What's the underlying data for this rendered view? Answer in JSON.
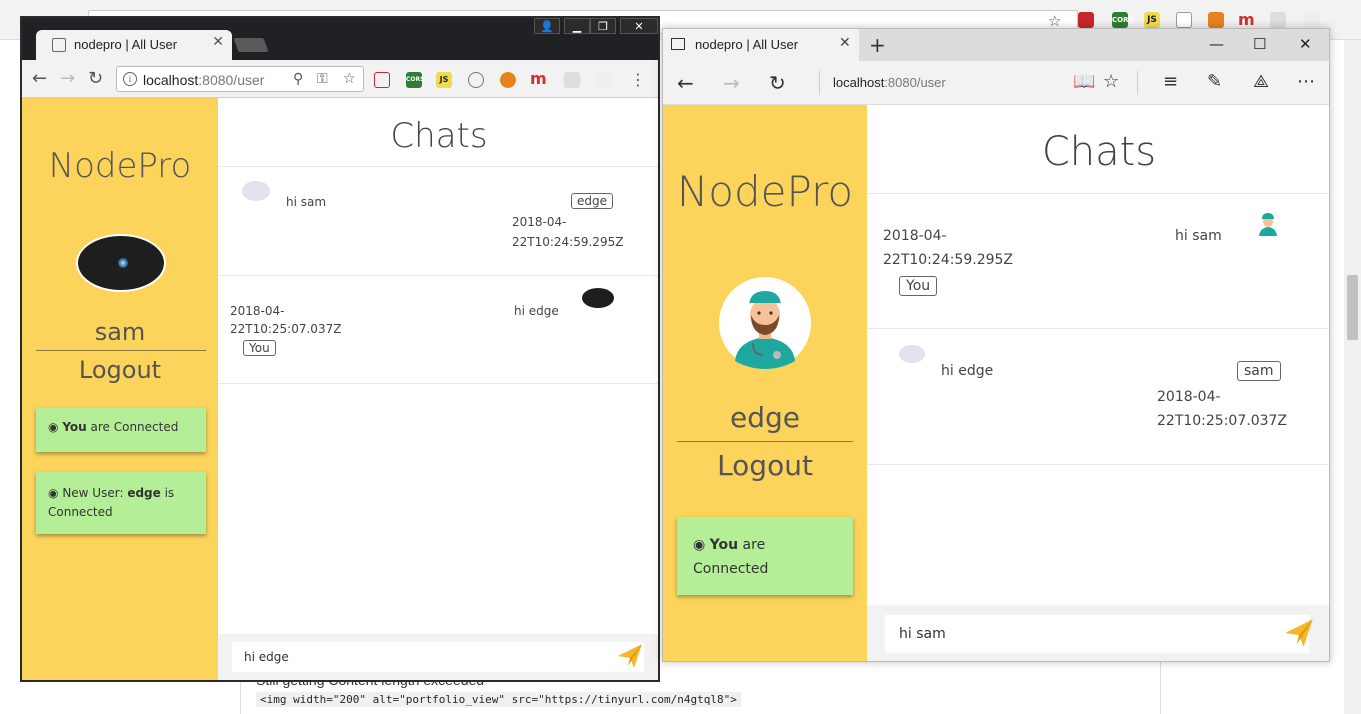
{
  "chrome": {
    "tab_title": "nodepro | All User",
    "url_host": "localhost",
    "url_rest": ":8080/user",
    "ext_cors": "CORS",
    "ext_js": "JS",
    "ext_m": "m",
    "app": {
      "brand": "NodePro",
      "username": "sam",
      "logout": "Logout",
      "notifications": [
        {
          "bold": "You",
          "text": " are Connected"
        },
        {
          "prefix": "New User: ",
          "bold": "edge",
          "text": " is Connected"
        }
      ],
      "chats_title": "Chats",
      "messages": [
        {
          "text": "hi sam",
          "sender": "edge",
          "timestamp_1": "2018-04-",
          "timestamp_2": "22T10:24:59.295Z"
        },
        {
          "text": "hi edge",
          "sender": "You",
          "timestamp_1": "2018-04-",
          "timestamp_2": "22T10:25:07.037Z"
        }
      ],
      "input_value": "hi edge",
      "avatar_icon": "galaxy-avatar-icon"
    }
  },
  "edge": {
    "tab_title": "nodepro | All User",
    "url_host": "localhost",
    "url_rest": ":8080/user",
    "app": {
      "brand": "NodePro",
      "username": "edge",
      "logout": "Logout",
      "notifications": [
        {
          "bold": "You",
          "text": " are Connected"
        }
      ],
      "chats_title": "Chats",
      "messages": [
        {
          "text": "hi sam",
          "sender": "You",
          "timestamp_1": "2018-04-",
          "timestamp_2": "22T10:24:59.295Z"
        },
        {
          "text": "hi edge",
          "sender": "sam",
          "timestamp_1": "2018-04-",
          "timestamp_2": "22T10:25:07.037Z"
        }
      ],
      "input_value": "hi sam",
      "avatar_icon": "doctor-avatar-icon"
    }
  },
  "background": {
    "text_line": "Still getting Content length exceeded",
    "code_line": "<img width=\"200\" alt=\"portfolio_view\" src=\"https://tinyurl.com/n4gtql8\">"
  },
  "colors": {
    "sidebar": "#fcd45b",
    "notification": "#b4ef97",
    "send_icon": "#f7b52a"
  }
}
